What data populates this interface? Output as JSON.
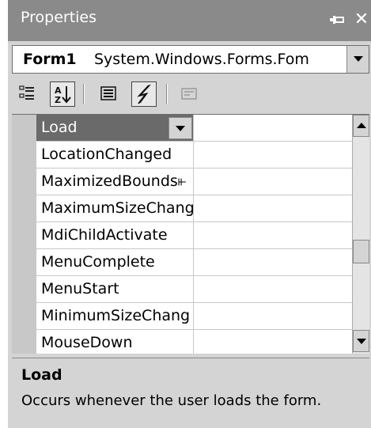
{
  "window": {
    "title": "Properties"
  },
  "object_selector": {
    "name": "Form1",
    "type": "System.Windows.Forms.Fom"
  },
  "toolbar": {
    "buttons": [
      {
        "icon": "categorized-icon",
        "pressed": false
      },
      {
        "icon": "alphabetical-icon",
        "pressed": true
      },
      {
        "icon": "properties-icon",
        "pressed": false
      },
      {
        "icon": "events-icon",
        "pressed": true
      },
      {
        "icon": "property-pages-icon",
        "pressed": false
      }
    ]
  },
  "grid": {
    "rows": [
      {
        "name": "Load",
        "value": "",
        "selected": true
      },
      {
        "name": "LocationChanged",
        "value": ""
      },
      {
        "name": "MaximizedBounds⫦",
        "value": ""
      },
      {
        "name": "MaximumSizeChang",
        "value": ""
      },
      {
        "name": "MdiChildActivate",
        "value": ""
      },
      {
        "name": "MenuComplete",
        "value": ""
      },
      {
        "name": "MenuStart",
        "value": ""
      },
      {
        "name": "MinimumSizeChang",
        "value": ""
      },
      {
        "name": "MouseDown",
        "value": ""
      }
    ]
  },
  "description": {
    "title": "Load",
    "text": "Occurs whenever the user loads the form."
  },
  "colors": {
    "titlebar": "#8a8a8a",
    "panel": "#d4d4d4",
    "selected_row": "#6a6a6a"
  }
}
